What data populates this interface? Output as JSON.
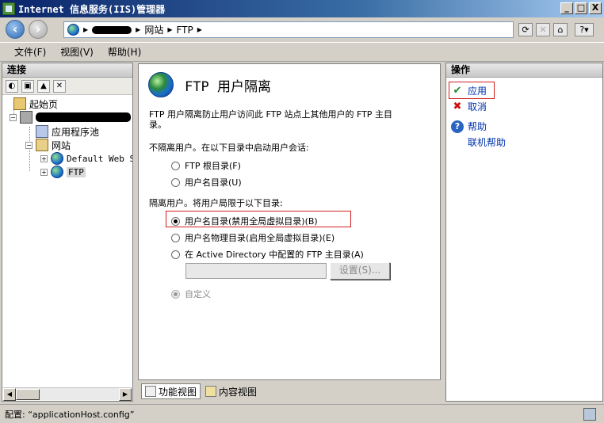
{
  "window": {
    "title": "Internet 信息服务(IIS)管理器",
    "buttons": [
      "_",
      "□",
      "X"
    ]
  },
  "address": {
    "crumbs": [
      "网站",
      "FTP"
    ]
  },
  "menu": {
    "items": [
      "文件(F)",
      "视图(V)",
      "帮助(H)"
    ]
  },
  "connections": {
    "title": "连接",
    "tree": {
      "start_page": "起始页",
      "app_pools": "应用程序池",
      "sites": "网站",
      "default_site": "Default Web S:",
      "ftp_site": "FTP"
    }
  },
  "main": {
    "title": "FTP 用户隔离",
    "description_line1": "FTP 用户隔离防止用户访问此 FTP 站点上其他用户的 FTP 主目",
    "description_line2": "录。",
    "no_isolation_label": "不隔离用户。在以下目录中启动用户会话:",
    "option_ftp_root": "FTP 根目录(F)",
    "option_username_dir": "用户名目录(U)",
    "isolation_label": "隔离用户。将用户局限于以下目录:",
    "option_username_dir_no_global": "用户名目录(禁用全局虚拟目录)(B)",
    "option_username_physical": "用户名物理目录(启用全局虚拟目录)(E)",
    "option_active_directory": "在 Active Directory 中配置的 FTP 主目录(A)",
    "settings_button": "设置(S)...",
    "option_custom": "自定义",
    "selected_option": "option_username_dir_no_global"
  },
  "view_tabs": {
    "features": "功能视图",
    "content": "内容视图"
  },
  "actions": {
    "title": "操作",
    "apply": "应用",
    "cancel": "取消",
    "help": "帮助",
    "online_help": "联机帮助"
  },
  "status": {
    "text": "配置: “applicationHost.config”"
  },
  "colors": {
    "highlight_box": "#d02020",
    "link": "#0033aa"
  }
}
